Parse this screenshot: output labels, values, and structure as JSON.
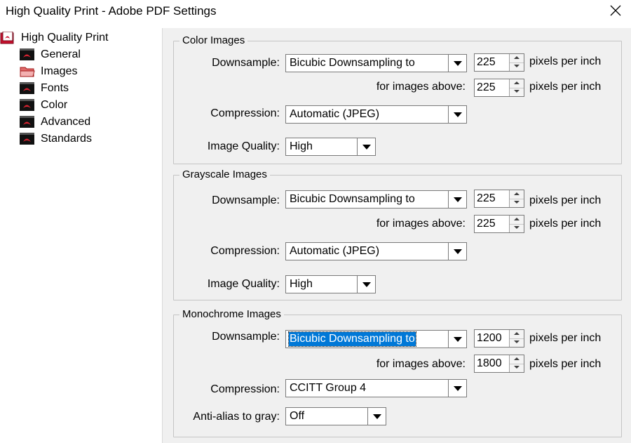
{
  "window": {
    "title": "High Quality Print - Adobe PDF Settings"
  },
  "tree": {
    "root": "High Quality Print",
    "items": [
      {
        "label": "General",
        "icon": "pdf-icon"
      },
      {
        "label": "Images",
        "icon": "folder-open-icon"
      },
      {
        "label": "Fonts",
        "icon": "pdf-icon"
      },
      {
        "label": "Color",
        "icon": "pdf-icon"
      },
      {
        "label": "Advanced",
        "icon": "pdf-icon"
      },
      {
        "label": "Standards",
        "icon": "pdf-icon"
      }
    ]
  },
  "labels": {
    "downsample": "Downsample:",
    "for_images_above": "for images above:",
    "compression": "Compression:",
    "image_quality": "Image Quality:",
    "anti_alias": "Anti-alias to gray:",
    "ppi": "pixels per inch"
  },
  "color": {
    "title": "Color Images",
    "downsample": "Bicubic Downsampling to",
    "resolution": "225",
    "above": "225",
    "compression": "Automatic (JPEG)",
    "quality": "High"
  },
  "grayscale": {
    "title": "Grayscale Images",
    "downsample": "Bicubic Downsampling to",
    "resolution": "225",
    "above": "225",
    "compression": "Automatic (JPEG)",
    "quality": "High"
  },
  "mono": {
    "title": "Monochrome Images",
    "downsample": "Bicubic Downsampling to",
    "resolution": "1200",
    "above": "1800",
    "compression": "CCITT Group 4",
    "anti_alias": "Off"
  },
  "colors": {
    "selection": "#0078d7",
    "panel_bg": "#f0f0f0",
    "icon_red": "#c8102e"
  }
}
